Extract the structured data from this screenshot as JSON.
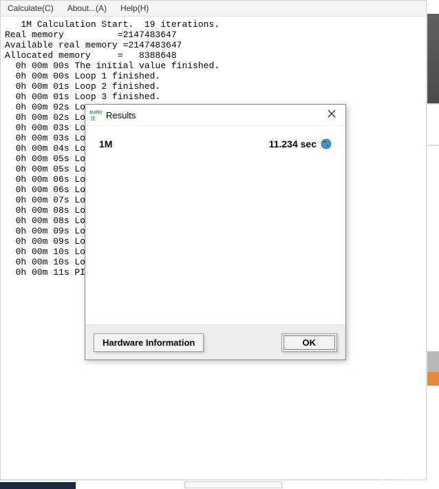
{
  "menu": {
    "calculate": "Calculate(C)",
    "about": "About...(A)",
    "help": "Help(H)"
  },
  "console": {
    "lines": [
      "   1M Calculation Start.  19 iterations.",
      "Real memory          =2147483647",
      "Available real memory =2147483647",
      "Allocated memory     =   8388648",
      "  0h 00m 00s The initial value finished.",
      "  0h 00m 00s Loop 1 finished.",
      "  0h 00m 01s Loop 2 finished.",
      "  0h 00m 01s Loop 3 finished.",
      "  0h 00m 02s Loo",
      "  0h 00m 02s Loo",
      "  0h 00m 03s Loo",
      "  0h 00m 03s Loo",
      "  0h 00m 04s Loo",
      "  0h 00m 05s Loo",
      "  0h 00m 05s Loo",
      "  0h 00m 06s Loo",
      "  0h 00m 06s Loo",
      "  0h 00m 07s Loo",
      "  0h 00m 08s Lo",
      "  0h 00m 08s Loo",
      "  0h 00m 09s Loo",
      "  0h 00m 09s Loo",
      "  0h 00m 10s Loo",
      "  0h 00m 10s Loo",
      "  0h 00m 11s PI"
    ]
  },
  "dialog": {
    "title": "Results",
    "result_label": "1M",
    "result_time": "11.234 sec",
    "hardware_button": "Hardware Information",
    "ok_button": "OK"
  },
  "watermark": {
    "text": "新浪众测"
  }
}
